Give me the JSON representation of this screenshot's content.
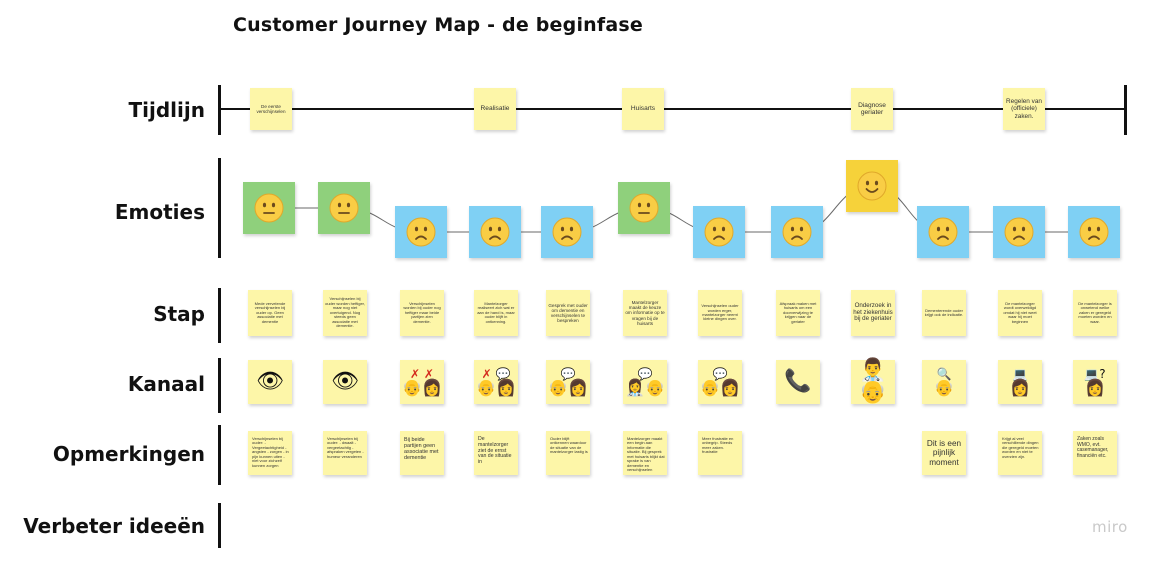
{
  "title": "Customer Journey Map - de beginfase",
  "row_labels": {
    "tijdlijn": "Tijdlijn",
    "emoties": "Emoties",
    "stap": "Stap",
    "kanaal": "Kanaal",
    "opmerkingen": "Opmerkingen",
    "verbeter": "Verbeter ideeën"
  },
  "timeline": [
    {
      "text": "De eerste verschijnselen"
    },
    {
      "text": "Realisatie"
    },
    {
      "text": "Huisarts"
    },
    {
      "text": "Diagnose geriater"
    },
    {
      "text": "Regelen van (officiele) zaken."
    }
  ],
  "emotions": [
    {
      "mood": "neutral",
      "color": "green"
    },
    {
      "mood": "neutral",
      "color": "green"
    },
    {
      "mood": "sad",
      "color": "blue"
    },
    {
      "mood": "sad",
      "color": "blue"
    },
    {
      "mood": "sad",
      "color": "blue"
    },
    {
      "mood": "neutral",
      "color": "green"
    },
    {
      "mood": "sad",
      "color": "blue"
    },
    {
      "mood": "sad",
      "color": "blue"
    },
    {
      "mood": "happy",
      "color": "gold"
    },
    {
      "mood": "sad",
      "color": "blue"
    },
    {
      "mood": "sad",
      "color": "blue"
    },
    {
      "mood": "sad",
      "color": "blue"
    }
  ],
  "steps": [
    "Mede vervelende verschijnselen bij ouder op. Geen associatie met dementie",
    "Verschijnselen bij ouder worden heftiger, maar nog niet overtuigend. Nog steeds geen associatie met dementie.",
    "Verschijnselen worden bij ouder nog heftiger maar beide partijen zien dementie.",
    "Mantelzorger realiseert zich wat er aan de hand is, maar ouder blijft in ontkenning.",
    "Gesprek met ouder om dementie en verschijnselen te bespreken",
    "Mantelzorger maakt de keuze om informatie op te vragen bij de huisarts",
    "Verschijnselen ouder worden erger, mantelzorger neemt kleine dingen over.",
    "Afspraak maken met huisarts om een doorverwijzing te krijgen naar de geriater",
    "Onderzoek in het ziekenhuis bij de geriater",
    "Dementerende ouder krijgt ook de indicatie.",
    "De mantelzorger wordt overweldigd omdat hij niet weet waar hij moet beginnen",
    "De mantelzorger is onwetend welke zaken er geregeld moeten worden en waar."
  ],
  "channels": [
    [
      "👁"
    ],
    [
      "👁"
    ],
    [
      "✗ ✗",
      "👴👩"
    ],
    [
      "✗ 💬",
      "👴👩"
    ],
    [
      "💬",
      "👴👩"
    ],
    [
      "💬",
      "👩‍⚕️👴"
    ],
    [
      "💬",
      "👴👩"
    ],
    [
      "📞"
    ],
    [
      "👨‍⚕️👴"
    ],
    [
      "🔍",
      "👴"
    ],
    [
      "💻",
      "👩"
    ],
    [
      "💻?",
      "👩"
    ]
  ],
  "remarks": [
    "Verschijnselen bij ouder: - Vergeetachtigheid - angsten - zorgen - in pijn kunnen uiten - niet voor zichzelf kunnen zorgen",
    "Verschijnselen bij ouder: - dwaalt - vergeetachtig - afspraken vergeten - humeur veranderen",
    "Bij beide partijen geen associatie met dementie",
    "De mantelzorger ziet de ernst van de situatie in",
    "Ouder blijft ontkennen waardoor de situatie van de mantelzorger lastig is",
    "Mantelzorger maakt een begin aan informatie die situatie. Bij gesprek met huisarts blijkt dat sprake is van dementie en verschijnselen",
    "Meer frustratie en onbegrip. Steeds meer zaken. frustratie",
    "",
    "",
    "Dit is een pijnlijk moment",
    "Krijgt al veel verschillende dingen die geregeld moeten worden en niet te overzien zijn.",
    "Zaken zoals WMO, evt. casemanager, financiën etc."
  ],
  "watermark": "miro"
}
